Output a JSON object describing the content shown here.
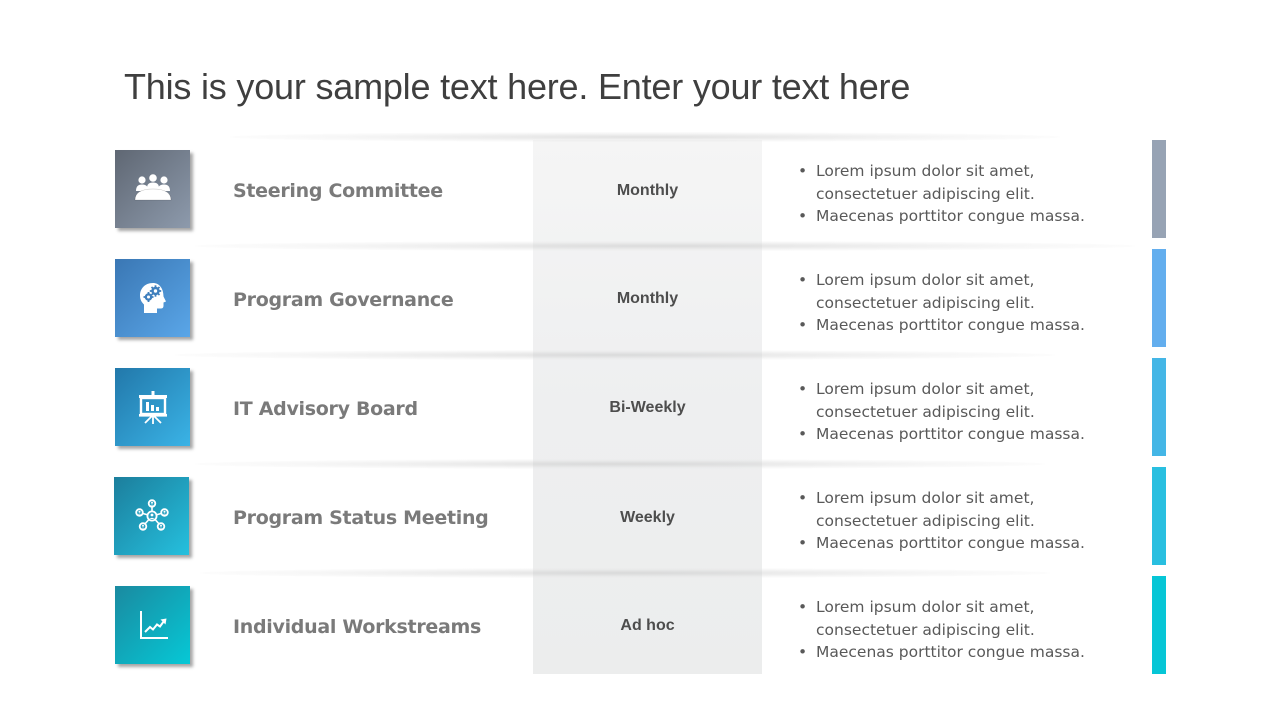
{
  "slide": {
    "title": "This is your sample text here. Enter your text here"
  },
  "rows": [
    {
      "name": "Steering Committee",
      "frequency": "Monthly",
      "icon": "meeting-group-icon",
      "accent_color": "#97a3b4",
      "icon_gradient": [
        "#5f6773",
        "#8d9aac"
      ],
      "bullets": [
        "Lorem ipsum dolor sit amet, consectetuer adipiscing elit.",
        "Maecenas porttitor congue massa."
      ]
    },
    {
      "name": "Program Governance",
      "frequency": "Monthly",
      "icon": "head-gears-icon",
      "accent_color": "#63aeee",
      "icon_gradient": [
        "#3a77b4",
        "#5aa6e8"
      ],
      "bullets": [
        "Lorem ipsum dolor sit amet, consectetuer adipiscing elit.",
        "Maecenas porttitor congue massa."
      ]
    },
    {
      "name": "IT Advisory Board",
      "frequency": "Bi-Weekly",
      "icon": "presentation-board-icon",
      "accent_color": "#44b6e6",
      "icon_gradient": [
        "#2278aa",
        "#3ab3e6"
      ],
      "bullets": [
        "Lorem ipsum dolor sit amet, consectetuer adipiscing elit.",
        "Maecenas porttitor congue massa."
      ]
    },
    {
      "name": "Program Status Meeting",
      "frequency": "Weekly",
      "icon": "network-people-icon",
      "accent_color": "#29bfe0",
      "icon_gradient": [
        "#1c7e9c",
        "#25c0de"
      ],
      "bullets": [
        "Lorem ipsum dolor sit amet, consectetuer adipiscing elit.",
        "Maecenas porttitor congue massa."
      ]
    },
    {
      "name": "Individual Workstreams",
      "frequency": "Ad hoc",
      "icon": "growth-chart-icon",
      "accent_color": "#06c6d6",
      "icon_gradient": [
        "#1a8aa0",
        "#06c8d6"
      ],
      "bullets": [
        "Lorem ipsum dolor sit amet, consectetuer adipiscing elit.",
        "Maecenas porttitor congue massa."
      ]
    }
  ]
}
